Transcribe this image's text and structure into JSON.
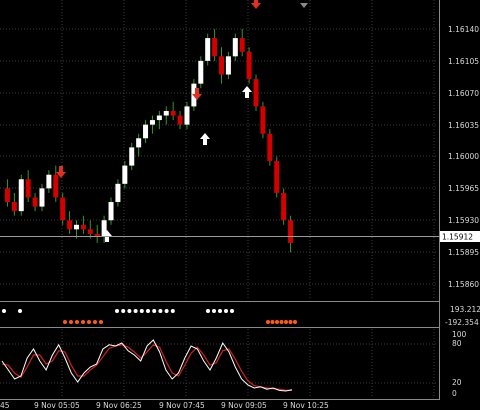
{
  "chart": {
    "symbol": "EURUSD",
    "current_price": "1.15912",
    "price_ticks": [
      "1.16140",
      "1.16105",
      "1.16070",
      "1.16035",
      "1.16000",
      "1.15965",
      "1.15930",
      "1.15895",
      "1.15860"
    ],
    "time_ticks": [
      "9 Nov 05:05",
      "9 Nov 06:25",
      "9 Nov 07:45",
      "9 Nov 09:05",
      "9 Nov 10:25"
    ],
    "time_partial": "45",
    "indicator1_levels": [
      "193.2121",
      "-192.354"
    ],
    "stoch_levels": [
      "100",
      "80",
      "20",
      "0"
    ]
  },
  "colors": {
    "background": "#000000",
    "grid": "#3a3a3a",
    "bull": "#ffffff",
    "bear": "#d40000",
    "wick": "#2e9a2e",
    "signal_up": "#ffffff",
    "signal_down": "#e0301e",
    "dot_white": "#ffffff",
    "dot_orange": "#ff5a1a",
    "stoch_main": "#ffffff",
    "stoch_signal": "#d42020"
  },
  "chart_data": {
    "type": "candlestick",
    "price_range": [
      1.1585,
      1.1617
    ],
    "candles_ohlc": [
      [
        1.15965,
        1.15975,
        1.15945,
        1.1595
      ],
      [
        1.1595,
        1.1596,
        1.15935,
        1.1594
      ],
      [
        1.1594,
        1.1598,
        1.15935,
        1.15975
      ],
      [
        1.15975,
        1.15985,
        1.1595,
        1.15955
      ],
      [
        1.15955,
        1.1596,
        1.1594,
        1.15945
      ],
      [
        1.15945,
        1.1597,
        1.1594,
        1.15965
      ],
      [
        1.15965,
        1.15985,
        1.1596,
        1.1598
      ],
      [
        1.1598,
        1.1599,
        1.1595,
        1.15955
      ],
      [
        1.15955,
        1.1596,
        1.15925,
        1.1593
      ],
      [
        1.1593,
        1.1594,
        1.15915,
        1.1592
      ],
      [
        1.1592,
        1.1593,
        1.1591,
        1.15925
      ],
      [
        1.15925,
        1.15935,
        1.15915,
        1.1592
      ],
      [
        1.1592,
        1.1593,
        1.1591,
        1.15915
      ],
      [
        1.15915,
        1.15925,
        1.15905,
        1.15912
      ],
      [
        1.15912,
        1.15935,
        1.15905,
        1.1593
      ],
      [
        1.1593,
        1.15955,
        1.15925,
        1.1595
      ],
      [
        1.1595,
        1.15975,
        1.15945,
        1.1597
      ],
      [
        1.1597,
        1.15995,
        1.15965,
        1.1599
      ],
      [
        1.1599,
        1.16015,
        1.15985,
        1.1601
      ],
      [
        1.1601,
        1.16025,
        1.16,
        1.1602
      ],
      [
        1.1602,
        1.1604,
        1.16015,
        1.16035
      ],
      [
        1.16035,
        1.16045,
        1.16025,
        1.1604
      ],
      [
        1.1604,
        1.1605,
        1.1603,
        1.16045
      ],
      [
        1.16045,
        1.16055,
        1.16035,
        1.1605
      ],
      [
        1.1605,
        1.1606,
        1.1604,
        1.16045
      ],
      [
        1.16045,
        1.1605,
        1.1603,
        1.16035
      ],
      [
        1.16035,
        1.1606,
        1.1603,
        1.16055
      ],
      [
        1.16055,
        1.16085,
        1.1605,
        1.1608
      ],
      [
        1.1608,
        1.1611,
        1.16075,
        1.16105
      ],
      [
        1.16105,
        1.16135,
        1.161,
        1.1613
      ],
      [
        1.1613,
        1.1614,
        1.16105,
        1.1611
      ],
      [
        1.1611,
        1.1612,
        1.1608,
        1.1609
      ],
      [
        1.1609,
        1.16115,
        1.16085,
        1.1611
      ],
      [
        1.1611,
        1.16135,
        1.16105,
        1.1613
      ],
      [
        1.1613,
        1.1614,
        1.1611,
        1.16115
      ],
      [
        1.16115,
        1.1612,
        1.1608,
        1.16085
      ],
      [
        1.16085,
        1.1609,
        1.1605,
        1.16055
      ],
      [
        1.16055,
        1.1606,
        1.1602,
        1.16025
      ],
      [
        1.16025,
        1.1603,
        1.1599,
        1.15995
      ],
      [
        1.15995,
        1.16,
        1.15955,
        1.1596
      ],
      [
        1.1596,
        1.15965,
        1.15925,
        1.1593
      ],
      [
        1.1593,
        1.15935,
        1.15895,
        1.15905
      ]
    ]
  }
}
